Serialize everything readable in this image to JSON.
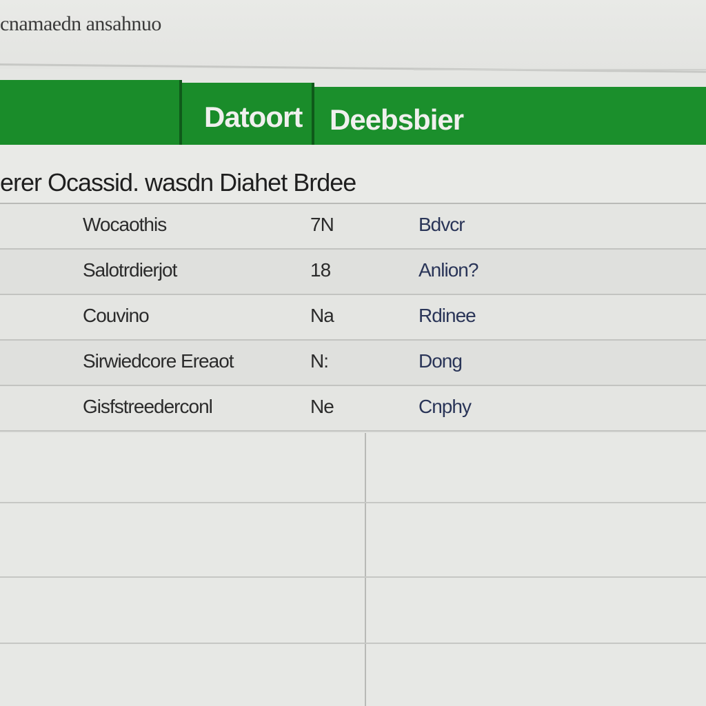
{
  "app": {
    "title": "cnamaedn ansahnuo"
  },
  "banner": {
    "tab_left": "",
    "tab_middle": "Datoort",
    "tab_right": "Deebsbier"
  },
  "table": {
    "header": "erer Ocassid. wasdn Diahet Brdee",
    "rows": [
      {
        "name": "Wocaothis",
        "value": "7N",
        "status": "Bdvcr"
      },
      {
        "name": "Salotrdierjot",
        "value": "18",
        "status": "Anlion?"
      },
      {
        "name": "Couvino",
        "value": "Na",
        "status": "Rdinee"
      },
      {
        "name": "Sirwiedcore Ereaot",
        "value": "N:",
        "status": "Dong"
      },
      {
        "name": "Gisfstreederconl",
        "value": "Ne",
        "status": "Cnphy"
      }
    ]
  },
  "colors": {
    "accent_green": "#1a8c2a",
    "background": "#e4e5e2"
  }
}
